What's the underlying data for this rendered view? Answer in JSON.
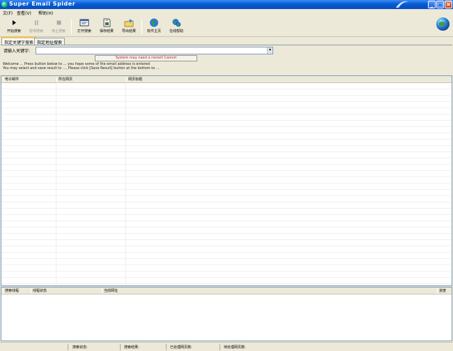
{
  "window": {
    "title": "Super Email Spider",
    "minimize": "_",
    "maximize": "□",
    "close": "×"
  },
  "menu": [
    "文(F)",
    "查看(V)",
    "帮助(H)"
  ],
  "toolbar": [
    {
      "label": "开始搜索",
      "icon": "play-icon",
      "disabled": false
    },
    {
      "label": "暂停搜索",
      "icon": "pause-icon",
      "disabled": true
    },
    {
      "label": "停止搜索",
      "icon": "stop-icon",
      "disabled": true
    },
    {
      "label": "打开搜索",
      "icon": "open-icon",
      "disabled": false
    },
    {
      "label": "保存结果",
      "icon": "save-icon",
      "disabled": false
    },
    {
      "label": "导出结果",
      "icon": "export-icon",
      "disabled": false
    },
    {
      "label": "软件主页",
      "icon": "homepage-icon",
      "disabled": false
    },
    {
      "label": "在线帮助",
      "icon": "help-icon",
      "disabled": false
    }
  ],
  "tabs": [
    "指定关键字搜索",
    "指定地址搜索"
  ],
  "search": {
    "label": "请输入关键字:",
    "value": "",
    "dropdown_icon": "▾",
    "system_button": "System may need a restart Cannot"
  },
  "help": {
    "line1": "Welcome ... Press button below to ... you hope some of the email address is entered",
    "line2": "You may select and save result to ..., Please click [Save Result] button at the bottom to ..."
  },
  "results_grid": {
    "columns": [
      "电子邮件",
      "所在网页",
      "网页标题"
    ],
    "rows": []
  },
  "tasks_grid": {
    "columns": [
      "搜索线程",
      "线程状态",
      "当前网址",
      "进度"
    ],
    "rows": []
  },
  "statusbar": {
    "search_status": "搜索状态:",
    "found": "搜索结果:",
    "processed": "已处理网页数:",
    "pending": "待处理网页数:"
  }
}
